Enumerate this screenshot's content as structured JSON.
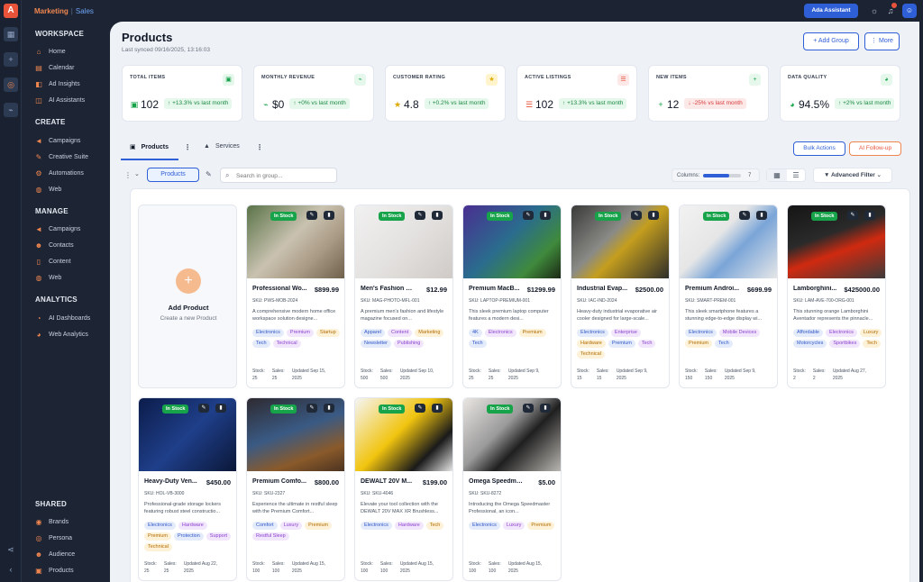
{
  "topbar": {
    "brand_marketing": "Marketing",
    "brand_separator": "|",
    "brand_sales": "Sales",
    "ada_label": "Ada Assistant"
  },
  "sidebar": {
    "workspace": {
      "title": "WORKSPACE",
      "items": [
        {
          "label": "Home"
        },
        {
          "label": "Calendar"
        },
        {
          "label": "Ad Insights"
        },
        {
          "label": "AI Assistants"
        }
      ]
    },
    "create": {
      "title": "CREATE",
      "items": [
        {
          "label": "Campaigns"
        },
        {
          "label": "Creative Suite"
        },
        {
          "label": "Automations"
        },
        {
          "label": "Web"
        }
      ]
    },
    "manage": {
      "title": "MANAGE",
      "items": [
        {
          "label": "Campaigns"
        },
        {
          "label": "Contacts"
        },
        {
          "label": "Content"
        },
        {
          "label": "Web"
        }
      ]
    },
    "analytics": {
      "title": "ANALYTICS",
      "items": [
        {
          "label": "AI Dashboards"
        },
        {
          "label": "Web Analytics"
        }
      ]
    },
    "shared": {
      "title": "SHARED",
      "items": [
        {
          "label": "Brands"
        },
        {
          "label": "Persona"
        },
        {
          "label": "Audience"
        },
        {
          "label": "Products"
        }
      ]
    }
  },
  "page": {
    "title": "Products",
    "synced": "Last synced 09/16/2025, 13:16:03",
    "add_group": "+ Add Group",
    "more": "⋮ More"
  },
  "stats": [
    {
      "label": "TOTAL ITEMS",
      "value": "102",
      "change": "↑ +13.3% vs last month",
      "trend": "up",
      "color": "#16a34a"
    },
    {
      "label": "MONTHLY REVENUE",
      "value": "$0",
      "change": "↑ +0% vs last month",
      "trend": "up",
      "color": "#16a34a"
    },
    {
      "label": "CUSTOMER RATING",
      "value": "4.8",
      "change": "↑ +0.2% vs last month",
      "trend": "up",
      "color": "#e0a800"
    },
    {
      "label": "ACTIVE LISTINGS",
      "value": "102",
      "change": "↑ +13.3% vs last month",
      "trend": "up",
      "color": "#e8533a"
    },
    {
      "label": "NEW ITEMS",
      "value": "12",
      "change": "↓ -25% vs last month",
      "trend": "down",
      "color": "#16a34a"
    },
    {
      "label": "DATA QUALITY",
      "value": "94.5%",
      "change": "↑ +2% vs last month",
      "trend": "up",
      "color": "#16a34a"
    }
  ],
  "tabs": [
    {
      "label": "Products"
    },
    {
      "label": "Services"
    }
  ],
  "actions": {
    "bulk": "Bulk Actions",
    "ai_followup": "AI Follow-up"
  },
  "toolbar": {
    "group_label": "Products",
    "search_placeholder": "Search in group...",
    "columns_label": "Columns:",
    "columns_value": "7",
    "columns_fraction": 0.7,
    "advanced_filter": "Advanced Filter"
  },
  "add_tile": {
    "title": "Add Product",
    "subtitle": "Create a new Product"
  },
  "products": [
    {
      "name": "Professional Wo...",
      "price": "$899.99",
      "sku": "SKU: PWS-MOB-2024",
      "status": "In Stock",
      "desc": "A comprehensive modern home office workspace solution designe...",
      "tags": [
        [
          "Electronics",
          "blue"
        ],
        [
          "Premium",
          "purple"
        ],
        [
          "Startup",
          "orange"
        ],
        [
          "Tech",
          "blue"
        ],
        [
          "Technical",
          "purple"
        ]
      ],
      "stock": "25",
      "sales": "25",
      "updated": "Updated Sep 15, 2025",
      "img": "img-office"
    },
    {
      "name": "Men's Fashion & L...",
      "price": "$12.99",
      "sku": "SKU: MAG-PHOTO-MFL-001",
      "status": "In Stock",
      "desc": "A premium men's fashion and lifestyle magazine focused on...",
      "tags": [
        [
          "Apparel",
          "blue"
        ],
        [
          "Content",
          "purple"
        ],
        [
          "Marketing",
          "orange"
        ],
        [
          "Newsletter",
          "blue"
        ],
        [
          "Publishing",
          "purple"
        ]
      ],
      "stock": "500",
      "sales": "500",
      "updated": "Updated Sep 10, 2025",
      "img": "img-fashion"
    },
    {
      "name": "Premium MacB...",
      "price": "$1299.99",
      "sku": "SKU: LAPTOP-PREMIUM-001",
      "status": "In Stock",
      "desc": "This sleek premium laptop computer features a modern desi...",
      "tags": [
        [
          "4K",
          "blue"
        ],
        [
          "Electronics",
          "purple"
        ],
        [
          "Premium",
          "orange"
        ],
        [
          "Tech",
          "blue"
        ]
      ],
      "stock": "25",
      "sales": "25",
      "updated": "Updated Sep 9, 2025",
      "img": "img-laptop"
    },
    {
      "name": "Industrial Evap...",
      "price": "$2500.00",
      "sku": "SKU: IAC-IND-2024",
      "status": "In Stock",
      "desc": "Heavy-duty industrial evaporative air cooler designed for large-scale...",
      "tags": [
        [
          "Electronics",
          "blue"
        ],
        [
          "Enterprise",
          "purple"
        ],
        [
          "Hardware",
          "orange"
        ],
        [
          "Premium",
          "blue"
        ],
        [
          "Tech",
          "purple"
        ],
        [
          "Technical",
          "orange"
        ]
      ],
      "stock": "15",
      "sales": "15",
      "updated": "Updated Sep 9, 2025",
      "img": "img-cooler"
    },
    {
      "name": "Premium Androi...",
      "price": "$699.99",
      "sku": "SKU: SMART-PREM-001",
      "status": "In Stock",
      "desc": "This sleek smartphone features a stunning edge-to-edge display wi...",
      "tags": [
        [
          "Electronics",
          "blue"
        ],
        [
          "Mobile Devices",
          "purple"
        ],
        [
          "Premium",
          "orange"
        ],
        [
          "Tech",
          "blue"
        ]
      ],
      "stock": "150",
      "sales": "150",
      "updated": "Updated Sep 9, 2025",
      "img": "img-phone"
    },
    {
      "name": "Lamborghini...",
      "price": "$425000.00",
      "sku": "SKU: LAM-AVE-700-ORG-001",
      "status": "In Stock",
      "desc": "This stunning orange Lamborghini Aventador represents the pinnacle...",
      "tags": [
        [
          "Affordable",
          "blue"
        ],
        [
          "Electronics",
          "purple"
        ],
        [
          "Luxury",
          "orange"
        ],
        [
          "Motorcycles",
          "blue"
        ],
        [
          "Sportbikes",
          "purple"
        ],
        [
          "Tech",
          "orange"
        ]
      ],
      "stock": "2",
      "sales": "2",
      "updated": "Updated Aug 27, 2025",
      "img": "img-lambo"
    },
    {
      "name": "Heavy-Duty Ven...",
      "price": "$450.00",
      "sku": "SKU: HOL-VB-3000",
      "status": "In Stock",
      "desc": "Professional-grade storage lockers featuring robust steel constructio...",
      "tags": [
        [
          "Electronics",
          "blue"
        ],
        [
          "Hardware",
          "purple"
        ],
        [
          "Premium",
          "orange"
        ],
        [
          "Protection",
          "blue"
        ],
        [
          "Support",
          "purple"
        ],
        [
          "Technical",
          "orange"
        ]
      ],
      "stock": "25",
      "sales": "25",
      "updated": "Updated Aug 22, 2025",
      "img": "img-locker"
    },
    {
      "name": "Premium Comfo...",
      "price": "$800.00",
      "sku": "SKU: SKU-2327",
      "status": "In Stock",
      "desc": "Experience the ultimate in restful sleep with the Premium Comfort...",
      "tags": [
        [
          "Comfort",
          "blue"
        ],
        [
          "Luxury",
          "purple"
        ],
        [
          "Premium",
          "orange"
        ],
        [
          "Restful Sleep",
          "purple"
        ]
      ],
      "stock": "100",
      "sales": "100",
      "updated": "Updated Aug 15, 2025",
      "img": "img-mattress"
    },
    {
      "name": "DEWALT 20V M...",
      "price": "$199.00",
      "sku": "SKU: SKU-4046",
      "status": "In Stock",
      "desc": "Elevate your tool collection with the DEWALT 20V MAX XR Brushless...",
      "tags": [
        [
          "Electronics",
          "blue"
        ],
        [
          "Hardware",
          "purple"
        ],
        [
          "Tech",
          "orange"
        ]
      ],
      "stock": "100",
      "sales": "100",
      "updated": "Updated Aug 15, 2025",
      "img": "img-drill"
    },
    {
      "name": "Omega Speedmast...",
      "price": "$5.00",
      "sku": "SKU: SKU-8272",
      "status": "In Stock",
      "desc": "Introducing the Omega Speedmaster Professional, an icon...",
      "tags": [
        [
          "Electronics",
          "blue"
        ],
        [
          "Luxury",
          "purple"
        ],
        [
          "Premium",
          "orange"
        ]
      ],
      "stock": "100",
      "sales": "100",
      "updated": "Updated Aug 15, 2025",
      "img": "img-watch"
    }
  ],
  "labels": {
    "stock": "Stock:",
    "sales": "Sales:"
  }
}
